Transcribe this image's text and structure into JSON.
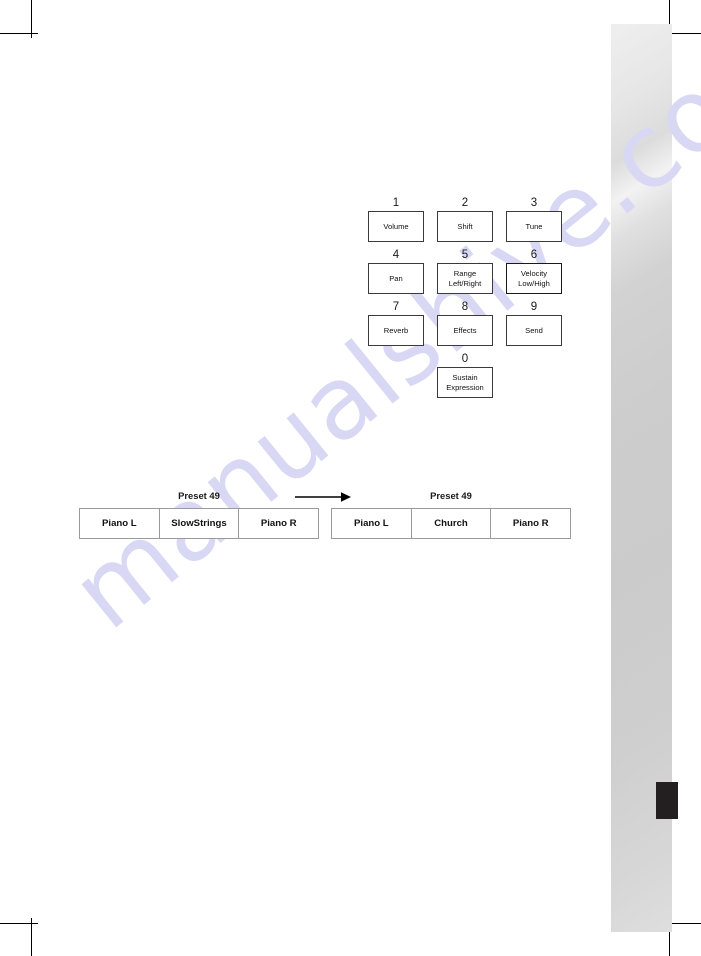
{
  "page": {
    "watermark_text": "manualshive.com",
    "background_color": "#ffffff",
    "side_band_color": "#cdcdcd",
    "side_tab_color": "#231f20"
  },
  "key_grid": {
    "rows": [
      [
        {
          "number": "1",
          "label": "Volume",
          "emphasis": false
        },
        {
          "number": "2",
          "label": "Shift",
          "emphasis": false
        },
        {
          "number": "3",
          "label": "Tune",
          "emphasis": false
        }
      ],
      [
        {
          "number": "4",
          "label": "Pan",
          "emphasis": false
        },
        {
          "number": "5",
          "label": "Range\nLeft/Right",
          "emphasis": false
        },
        {
          "number": "6",
          "label": "Velocity\nLow/High",
          "emphasis": true
        }
      ],
      [
        {
          "number": "7",
          "label": "Reverb",
          "emphasis": false
        },
        {
          "number": "8",
          "label": "Effects",
          "emphasis": false
        },
        {
          "number": "9",
          "label": "Send",
          "emphasis": false
        }
      ]
    ],
    "zero_key": {
      "number": "0",
      "label": "Sustain\nExpression",
      "emphasis": false
    }
  },
  "preset_left": {
    "title": "Preset 49",
    "cells": [
      "Piano L",
      "SlowStrings",
      "Piano R"
    ]
  },
  "preset_right": {
    "title": "Preset 49",
    "cells": [
      "Piano L",
      "Church",
      "Piano R"
    ]
  }
}
